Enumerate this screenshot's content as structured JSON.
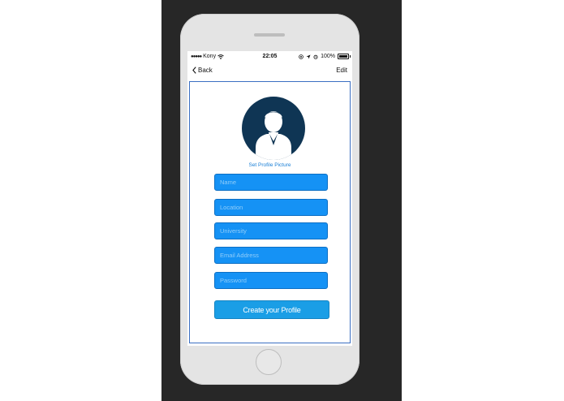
{
  "status_bar": {
    "carrier": "Kony",
    "time": "22:05",
    "battery": "100%"
  },
  "nav": {
    "back_label": "Back",
    "edit_label": "Edit"
  },
  "profile": {
    "set_picture_label": "Set Profile Picture",
    "avatar_color": "#0f3554"
  },
  "form": {
    "fields": [
      {
        "placeholder": "Name",
        "value": ""
      },
      {
        "placeholder": "Location",
        "value": ""
      },
      {
        "placeholder": "University",
        "value": ""
      },
      {
        "placeholder": "Email Address",
        "value": ""
      },
      {
        "placeholder": "Password",
        "value": ""
      }
    ],
    "submit_label": "Create your Profile"
  },
  "colors": {
    "field_fill": "#1592f5",
    "button_fill": "#1a9ee6",
    "frame_border": "#3b6fc2",
    "link": "#1a7fd6"
  }
}
